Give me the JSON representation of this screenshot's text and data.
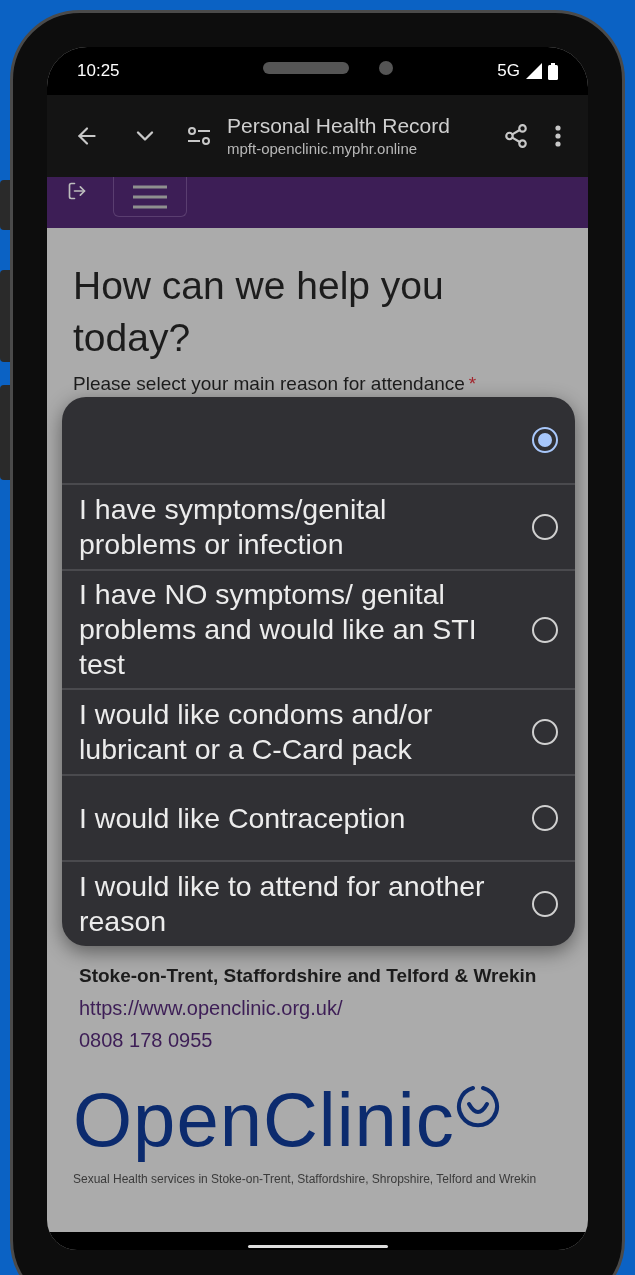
{
  "status_bar": {
    "time": "10:25",
    "network": "5G"
  },
  "browser": {
    "title": "Personal Health Record",
    "url": "mpft-openclinic.myphr.online"
  },
  "page": {
    "heading": "How can we help you today?",
    "field_label": "Please select your main reason for attendance",
    "required_mark": "*"
  },
  "dialog": {
    "options": [
      {
        "selected": true
      },
      {
        "label": "I have symptoms/genital problems or infection",
        "selected": false
      },
      {
        "label": "I have NO symptoms/ genital problems and would like an STI test",
        "selected": false
      },
      {
        "label": "I would like condoms and/or lubricant or a C-Card pack",
        "selected": false
      },
      {
        "label": "I would like Contraception",
        "selected": false
      },
      {
        "label": "I would like to attend for another reason",
        "selected": false
      }
    ]
  },
  "footer": {
    "region": "Stoke-on-Trent, Staffordshire and Telford & Wrekin",
    "url": "https://www.openclinic.org.uk/",
    "phone": "0808 178 0955",
    "logo": "OpenClinic",
    "tagline": "Sexual Health services in Stoke-on-Trent, Staffordshire, Shropshire, Telford and Wrekin"
  }
}
